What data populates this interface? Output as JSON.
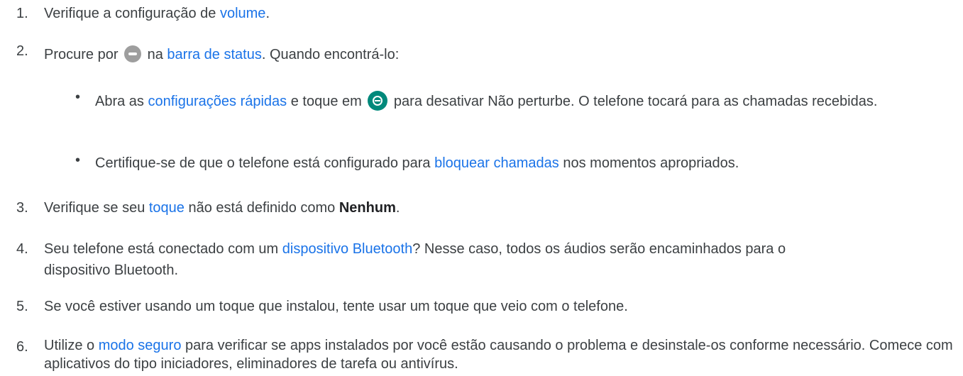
{
  "steps": [
    {
      "num": "1.",
      "pre": "Verifique a configuração de ",
      "link": "volume",
      "post": "."
    },
    {
      "num": "2.",
      "pre": "Procure por ",
      "mid": " na ",
      "link": "barra de status",
      "post": ". Quando encontrá-lo:"
    },
    {
      "num": "3.",
      "pre": "Verifique se seu ",
      "link": "toque",
      "mid": " não está definido como ",
      "bold": "Nenhum",
      "post": "."
    },
    {
      "num": "4.",
      "pre": "Seu telefone está conectado com um ",
      "link": "dispositivo Bluetooth",
      "post": "? Nesse caso, todos os áudios serão encaminhados para o dispositivo Bluetooth."
    },
    {
      "num": "5.",
      "text": "Se você estiver usando um toque que instalou, tente usar um toque que veio com o telefone."
    },
    {
      "num": "6.",
      "pre": "Utilize o ",
      "link": "modo seguro",
      "post": " para verificar se apps instalados por você estão causando o problema e desinstale-os conforme necessário. Comece com aplicativos do tipo iniciadores, eliminadores de tarefa ou antivírus."
    }
  ],
  "bullets": [
    {
      "marker": "•",
      "pre": "Abra as ",
      "link": "configurações rápidas",
      "mid": " e toque em ",
      "post": " para desativar Não perturbe. O telefone tocará para as chamadas recebidas."
    },
    {
      "marker": "•",
      "pre": "Certifique-se de que o telefone está configurado para ",
      "link": "bloquear chamadas",
      "post": " nos momentos apropriados."
    }
  ],
  "icons": {
    "dnd": "do-not-disturb-icon",
    "qs": "dnd-quick-setting-icon"
  },
  "colors": {
    "link": "#1a73e8",
    "text": "#3c4043",
    "dnd_icon": "#9e9e9e",
    "qs_icon": "#00897b"
  }
}
